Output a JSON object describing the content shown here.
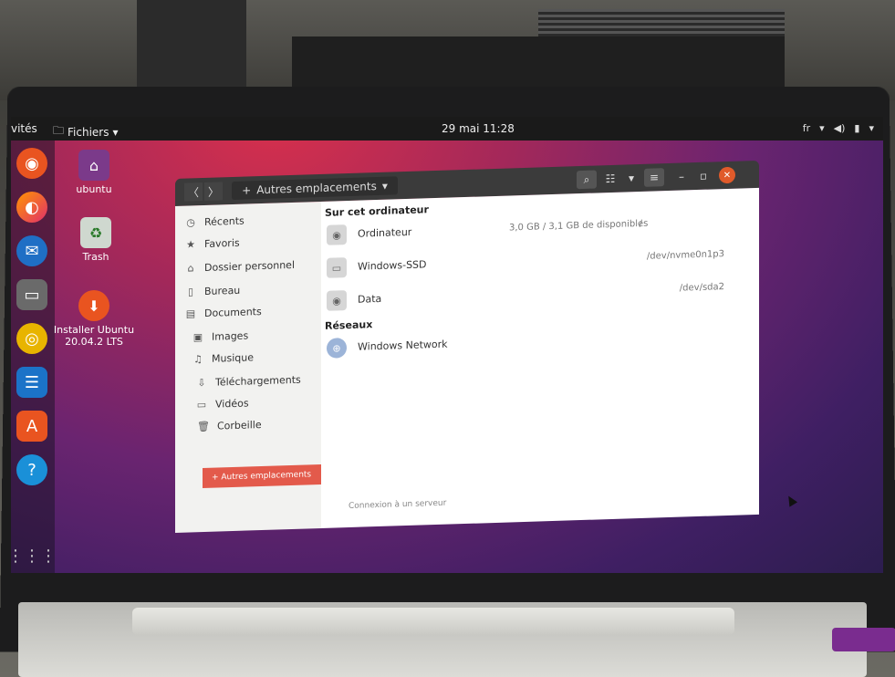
{
  "topbar": {
    "activities": "vités",
    "files_menu": "Fichiers",
    "clock": "29 mai 11:28",
    "tray_lang": "fr",
    "tray_sound": "◀)",
    "tray_battery": "▮"
  },
  "desktop": {
    "icons": [
      {
        "label": "ubuntu"
      },
      {
        "label": "Trash"
      },
      {
        "label": "Installer Ubuntu 20.04.2 LTS"
      }
    ]
  },
  "window": {
    "path_label": "Autres emplacements",
    "sidebar": {
      "items": [
        {
          "label": "Récents",
          "icon": "clock-icon"
        },
        {
          "label": "Favoris",
          "icon": "star-icon"
        },
        {
          "label": "Dossier personnel",
          "icon": "home-icon"
        },
        {
          "label": "Bureau",
          "icon": "desktop-icon"
        },
        {
          "label": "Documents",
          "icon": "document-icon"
        },
        {
          "label": "Images",
          "icon": "image-icon"
        },
        {
          "label": "Musique",
          "icon": "music-icon"
        },
        {
          "label": "Téléchargements",
          "icon": "download-icon"
        },
        {
          "label": "Vidéos",
          "icon": "video-icon"
        },
        {
          "label": "Corbeille",
          "icon": "trash-icon"
        }
      ],
      "active": "+ Autres emplacements"
    },
    "main": {
      "on_this_computer": "Sur cet ordinateur",
      "devices": [
        {
          "name": "Ordinateur",
          "size": "3,0 GB / 3,1 GB de disponibles",
          "path": "/"
        },
        {
          "name": "Windows-SSD",
          "size": "",
          "path": "/dev/nvme0n1p3"
        },
        {
          "name": "Data",
          "size": "",
          "path": "/dev/sda2"
        }
      ],
      "networks_title": "Réseaux",
      "networks": [
        {
          "name": "Windows Network"
        }
      ],
      "server_link": "Connexion à un serveur"
    }
  },
  "colors": {
    "accent": "#e35a4b",
    "topbar": "#1a1a1a",
    "header": "#3b3b3b"
  }
}
